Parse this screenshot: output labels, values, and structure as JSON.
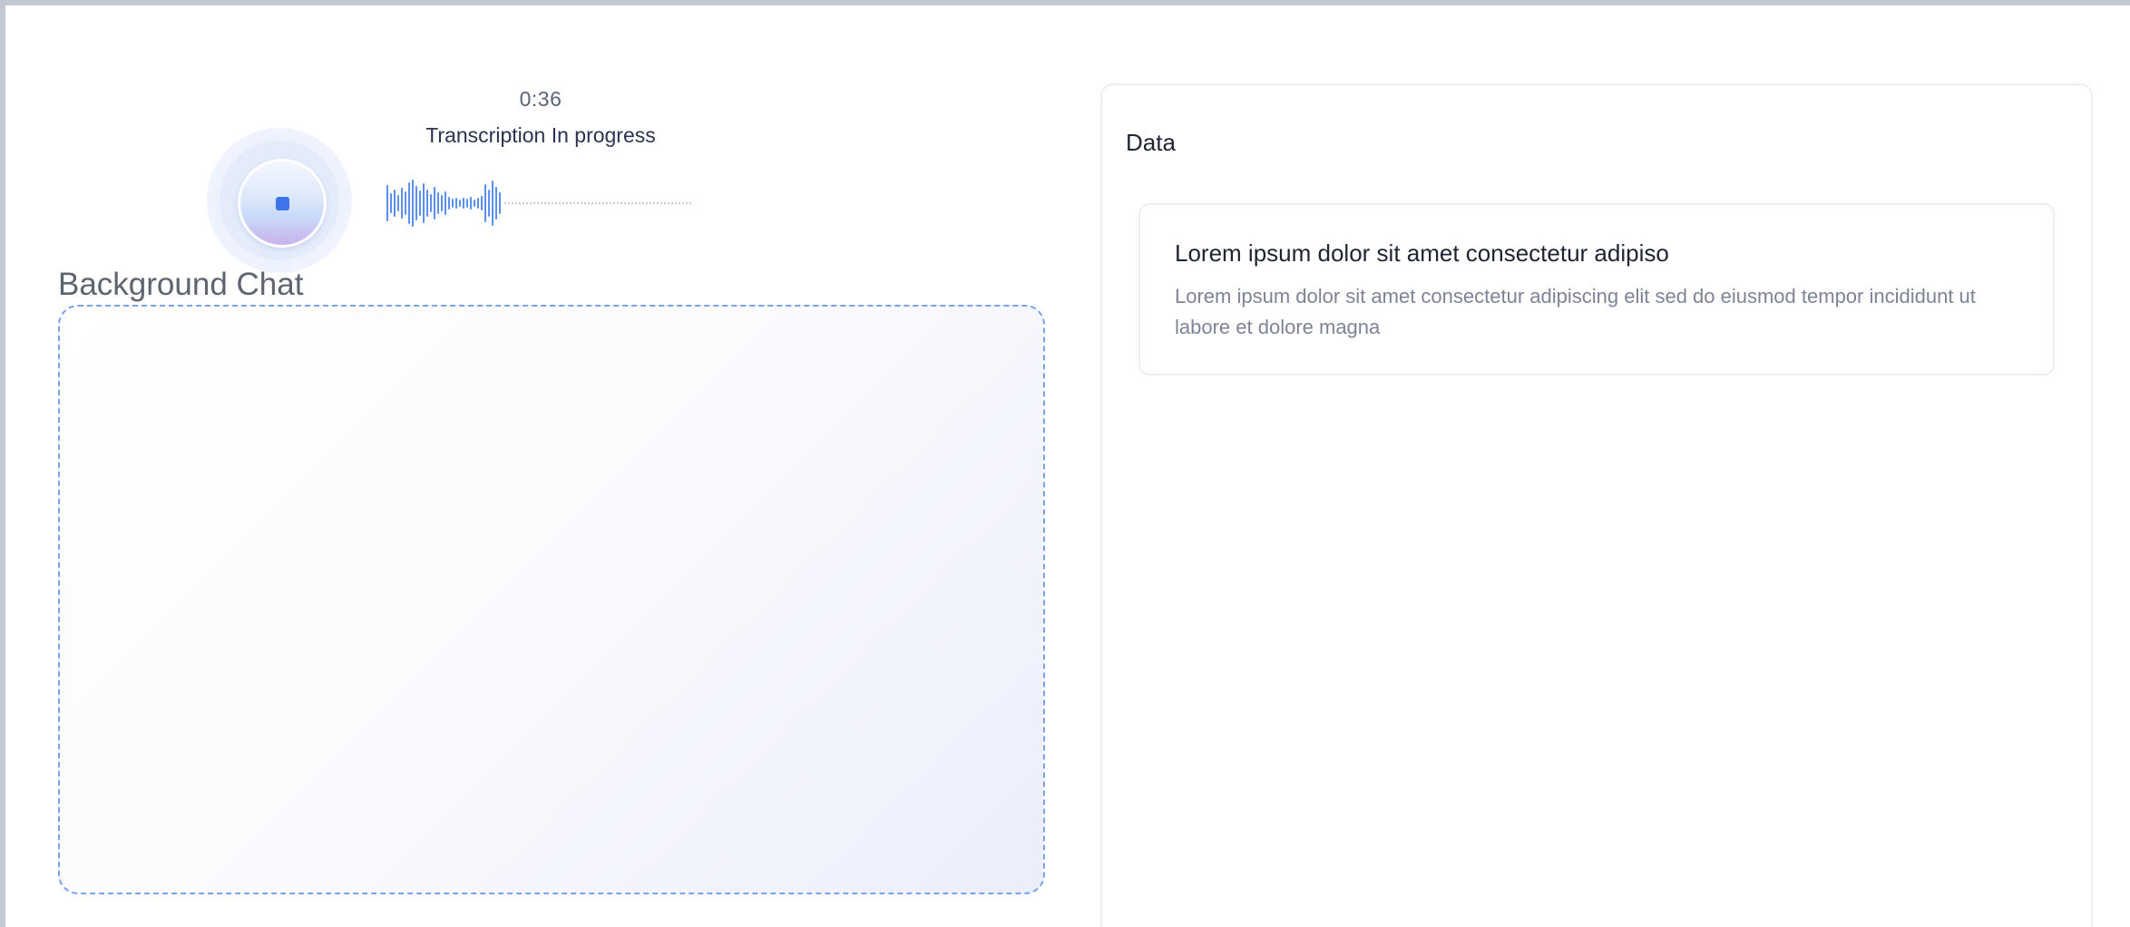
{
  "recorder": {
    "timer": "0:36",
    "status": "Transcription In progress",
    "stop_icon": "stop-icon",
    "waveform_icon": "audio-waveform"
  },
  "chat": {
    "title": "Background Chat"
  },
  "data_panel": {
    "title": "Data",
    "cards": [
      {
        "title": "Lorem ipsum dolor sit amet consectetur adipiso",
        "description": "Lorem ipsum dolor sit amet consectetur adipiscing elit sed do eiusmod tempor incididunt ut labore et dolore magna"
      }
    ]
  },
  "colors": {
    "accent": "#3f74ea",
    "waveform": "#5a8ff0",
    "dropzone_border": "#7aa3ef"
  }
}
